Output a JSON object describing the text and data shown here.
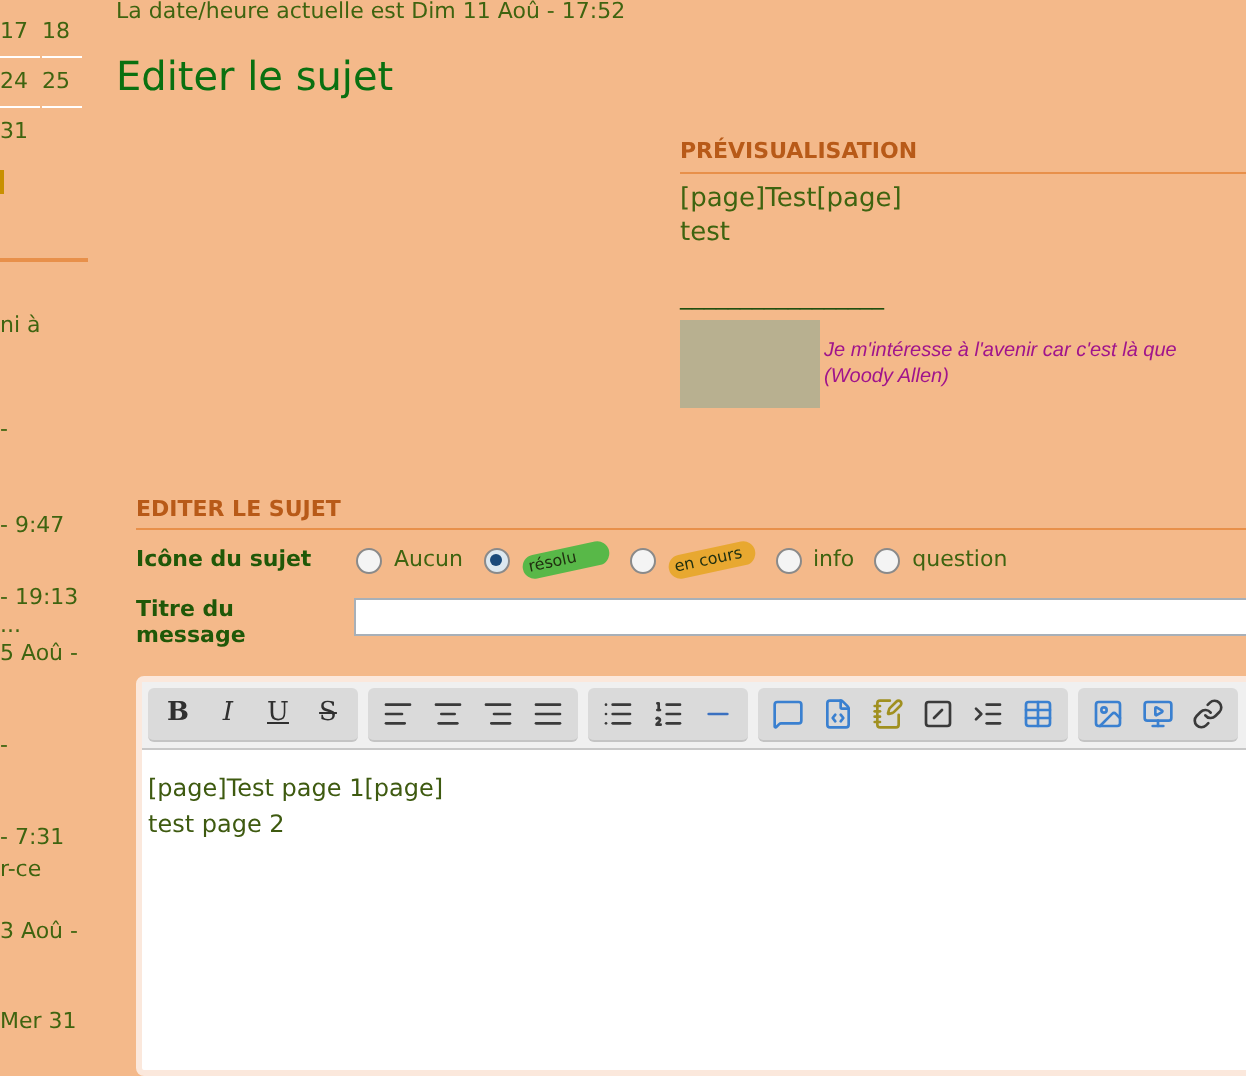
{
  "sidebar": {
    "calendar_rows": [
      [
        "17",
        "18"
      ],
      [
        "24",
        "25"
      ],
      [
        "31"
      ]
    ],
    "items": [
      "ni à",
      "-",
      "- 9:47",
      "- 19:13",
      "...",
      "5 Aoû -",
      "-",
      "- 7:31",
      "r-ce",
      "3 Aoû -",
      "Mer 31"
    ]
  },
  "datetime": "La date/heure actuelle est Dim 11 Aoû - 17:52",
  "page_title": "Editer le sujet",
  "preview": {
    "heading": "PRÉVISUALISATION",
    "lines": [
      "[page]Test[page]",
      "test"
    ],
    "signature_rule": "_________________",
    "quote_lines": [
      "Je m'intéresse à l'avenir car c'est là que",
      "(Woody Allen)"
    ]
  },
  "form": {
    "heading": "EDITER LE SUJET",
    "icon_label": "Icône du sujet",
    "icon_options": [
      {
        "kind": "text",
        "label": "Aucun",
        "selected": false
      },
      {
        "kind": "badge",
        "label": "résolu",
        "color": "#58b848",
        "selected": true
      },
      {
        "kind": "badge",
        "label": "en cours",
        "color": "#e8a830",
        "selected": false
      },
      {
        "kind": "text",
        "label": "info",
        "selected": false
      },
      {
        "kind": "text",
        "label": "question",
        "selected": false
      }
    ],
    "title_label": "Titre du message"
  },
  "editor": {
    "format_buttons": [
      "B",
      "I",
      "U",
      "S"
    ],
    "lines": [
      "[page]Test page 1[page]",
      "test page 2"
    ]
  }
}
